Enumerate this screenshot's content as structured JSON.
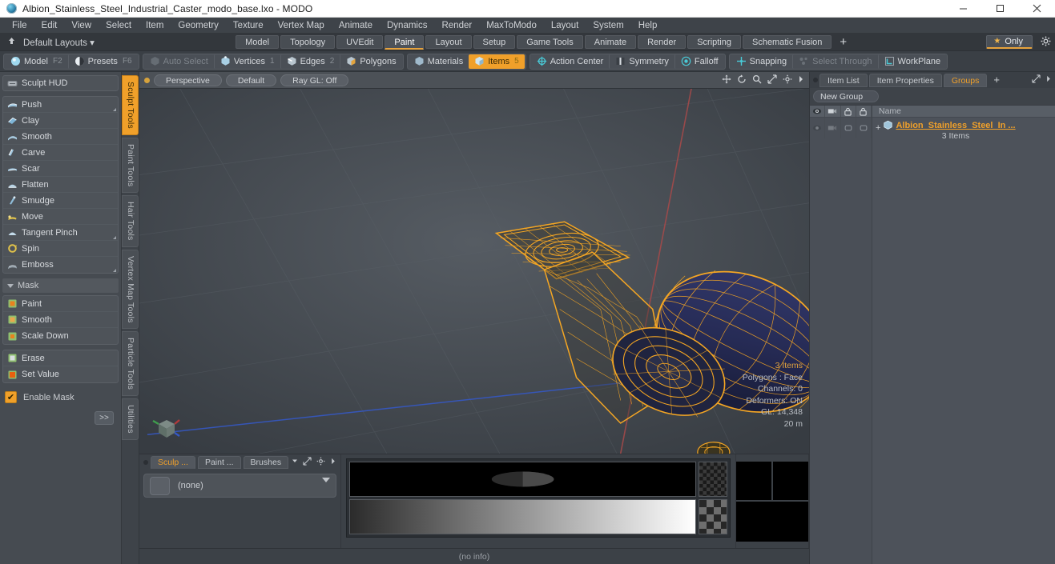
{
  "window": {
    "title": "Albion_Stainless_Steel_Industrial_Caster_modo_base.lxo - MODO",
    "app_icon": "modo-sphere-icon",
    "minimize": "−",
    "maximize": "▢",
    "close": "✕"
  },
  "menubar": {
    "items": [
      "File",
      "Edit",
      "View",
      "Select",
      "Item",
      "Geometry",
      "Texture",
      "Vertex Map",
      "Animate",
      "Dynamics",
      "Render",
      "MaxToModo",
      "Layout",
      "System",
      "Help"
    ]
  },
  "layoutbar": {
    "pin_icon": "pin-icon",
    "layout_selector": "Default Layouts",
    "tabs": [
      {
        "label": "Model",
        "active": false
      },
      {
        "label": "Topology",
        "active": false
      },
      {
        "label": "UVEdit",
        "active": false
      },
      {
        "label": "Paint",
        "active": true
      },
      {
        "label": "Layout",
        "active": false
      },
      {
        "label": "Setup",
        "active": false
      },
      {
        "label": "Game Tools",
        "active": false
      },
      {
        "label": "Animate",
        "active": false
      },
      {
        "label": "Render",
        "active": false
      },
      {
        "label": "Scripting",
        "active": false
      },
      {
        "label": "Schematic Fusion",
        "active": false
      }
    ],
    "add_tab": "+",
    "only_label": "Only",
    "star_icon": "star-icon",
    "gear_icon": "gear-icon"
  },
  "modebar": {
    "group_mode": [
      {
        "label": "Model",
        "shortcut": "F2",
        "icon": "sphere-icon",
        "state": "normal"
      },
      {
        "label": "Presets",
        "shortcut": "F6",
        "icon": "preset-sphere-icon",
        "state": "normal"
      }
    ],
    "group_select": [
      {
        "label": "Auto Select",
        "num": "",
        "icon": "cube-icon",
        "state": "dim"
      },
      {
        "label": "Vertices",
        "num": "1",
        "icon": "cube-vertex-icon",
        "state": "normal"
      },
      {
        "label": "Edges",
        "num": "2",
        "icon": "cube-edge-icon",
        "state": "normal"
      },
      {
        "label": "Polygons",
        "num": "",
        "icon": "cube-poly-icon",
        "state": "normal"
      }
    ],
    "group_items": [
      {
        "label": "Materials",
        "num": "",
        "icon": "cube-material-icon",
        "state": "normal"
      },
      {
        "label": "Items",
        "num": "5",
        "icon": "cube-item-icon",
        "state": "active"
      }
    ],
    "group_tools": [
      {
        "label": "Action Center",
        "icon": "action-center-icon",
        "state": "normal"
      },
      {
        "label": "Symmetry",
        "icon": "symmetry-icon",
        "state": "normal"
      },
      {
        "label": "Falloff",
        "icon": "falloff-icon",
        "state": "normal"
      }
    ],
    "group_snap": [
      {
        "label": "Snapping",
        "icon": "snapping-icon",
        "state": "normal"
      },
      {
        "label": "Select Through",
        "icon": "select-through-icon",
        "state": "dim"
      },
      {
        "label": "WorkPlane",
        "icon": "workplane-icon",
        "state": "normal"
      }
    ]
  },
  "sculpt_panel": {
    "hud_button": {
      "label": "Sculpt HUD",
      "icon": "hud-icon"
    },
    "tools": [
      {
        "label": "Push",
        "icon": "brush-push-icon",
        "corner": true
      },
      {
        "label": "Clay",
        "icon": "brush-clay-icon",
        "corner": false
      },
      {
        "label": "Smooth",
        "icon": "brush-smooth-icon",
        "corner": false
      },
      {
        "label": "Carve",
        "icon": "brush-carve-icon",
        "corner": false
      },
      {
        "label": "Scar",
        "icon": "brush-scar-icon",
        "corner": false
      },
      {
        "label": "Flatten",
        "icon": "brush-flatten-icon",
        "corner": false
      },
      {
        "label": "Smudge",
        "icon": "brush-smudge-icon",
        "corner": false
      },
      {
        "label": "Move",
        "icon": "brush-move-icon",
        "corner": false
      },
      {
        "label": "Tangent Pinch",
        "icon": "brush-pinch-icon",
        "corner": true
      },
      {
        "label": "Spin",
        "icon": "brush-spin-icon",
        "corner": false
      },
      {
        "label": "Emboss",
        "icon": "brush-emboss-icon",
        "corner": true
      }
    ],
    "mask_section": "Mask",
    "mask_tools": [
      {
        "label": "Paint",
        "icon": "mask-paint-icon"
      },
      {
        "label": "Smooth",
        "icon": "mask-smooth-icon"
      },
      {
        "label": "Scale Down",
        "icon": "mask-scaledown-icon"
      }
    ],
    "mask_tools2": [
      {
        "label": "Erase",
        "icon": "mask-erase-icon"
      },
      {
        "label": "Set Value",
        "icon": "mask-setvalue-icon"
      }
    ],
    "enable_mask": {
      "label": "Enable Mask",
      "checked": true
    },
    "expand_button": ">>"
  },
  "vertical_tabs": [
    {
      "label": "Sculpt Tools",
      "active": true
    },
    {
      "label": "Paint Tools",
      "active": false
    },
    {
      "label": "Hair Tools",
      "active": false
    },
    {
      "label": "Vertex Map Tools",
      "active": false
    },
    {
      "label": "Particle Tools",
      "active": false
    },
    {
      "label": "Utilities",
      "active": false
    }
  ],
  "viewport": {
    "header": {
      "dot_icon": "viewport-menu-dot-icon",
      "chips": [
        "Perspective",
        "Default",
        "Ray GL: Off"
      ],
      "icons": [
        "move-icon",
        "rotate-icon",
        "zoom-icon",
        "fit-icon",
        "gear-icon",
        "arrow-right-icon"
      ]
    },
    "stats": {
      "items": "3 Items",
      "polygons": "Polygons : Face",
      "channels": "Channels: 0",
      "deformers": "Deformers: ON",
      "gl": "GL: 14,348",
      "scale": "20 m"
    },
    "axis_gizmo": "axis-cube-icon",
    "model": {
      "name": "industrial caster wheel wireframe",
      "wire_color": "#f5a623",
      "shaded_color": "#2a2a55",
      "grid_color": "#5a6066",
      "x_axis_color": "#b04848",
      "z_axis_color": "#3a5fc0"
    }
  },
  "bottom_dock": {
    "sculpt_tabs": [
      {
        "label": "Sculp ...",
        "active": true
      },
      {
        "label": "Paint ...",
        "active": false
      },
      {
        "label": "Brushes",
        "active": false
      }
    ],
    "tab_caret": "chevron-down-icon",
    "tab_icons": [
      "expand-icon",
      "gear-icon",
      "arrow-right-icon"
    ],
    "brush_value": "(none)",
    "brush_swatch": "brush-preview-swatch",
    "gradient_panel": "alpha-and-gradient-ramp",
    "preview_panel": "image-preview-tiles",
    "status_text": "(no info)"
  },
  "right_panel": {
    "tabs": [
      {
        "label": "Item List",
        "active": false
      },
      {
        "label": "Item Properties",
        "active": false
      },
      {
        "label": "Groups",
        "active": true
      }
    ],
    "add_tab": "+",
    "tab_icons": [
      "expand-icon",
      "arrow-right-icon"
    ],
    "new_group_button": "New Group",
    "columns": [
      {
        "icon": "eye-icon",
        "name": "visibility-column"
      },
      {
        "icon": "render-camera-icon",
        "name": "render-column"
      },
      {
        "icon": "lock-icon",
        "name": "lock-column"
      },
      {
        "icon": "lock-alt-icon",
        "name": "lock-alt-column"
      }
    ],
    "name_header": "Name",
    "rows": [
      {
        "expander": "+",
        "icon": "group-item-icon",
        "name": "Albion_Stainless_Steel_In ...",
        "subtitle": "3 Items"
      }
    ]
  }
}
